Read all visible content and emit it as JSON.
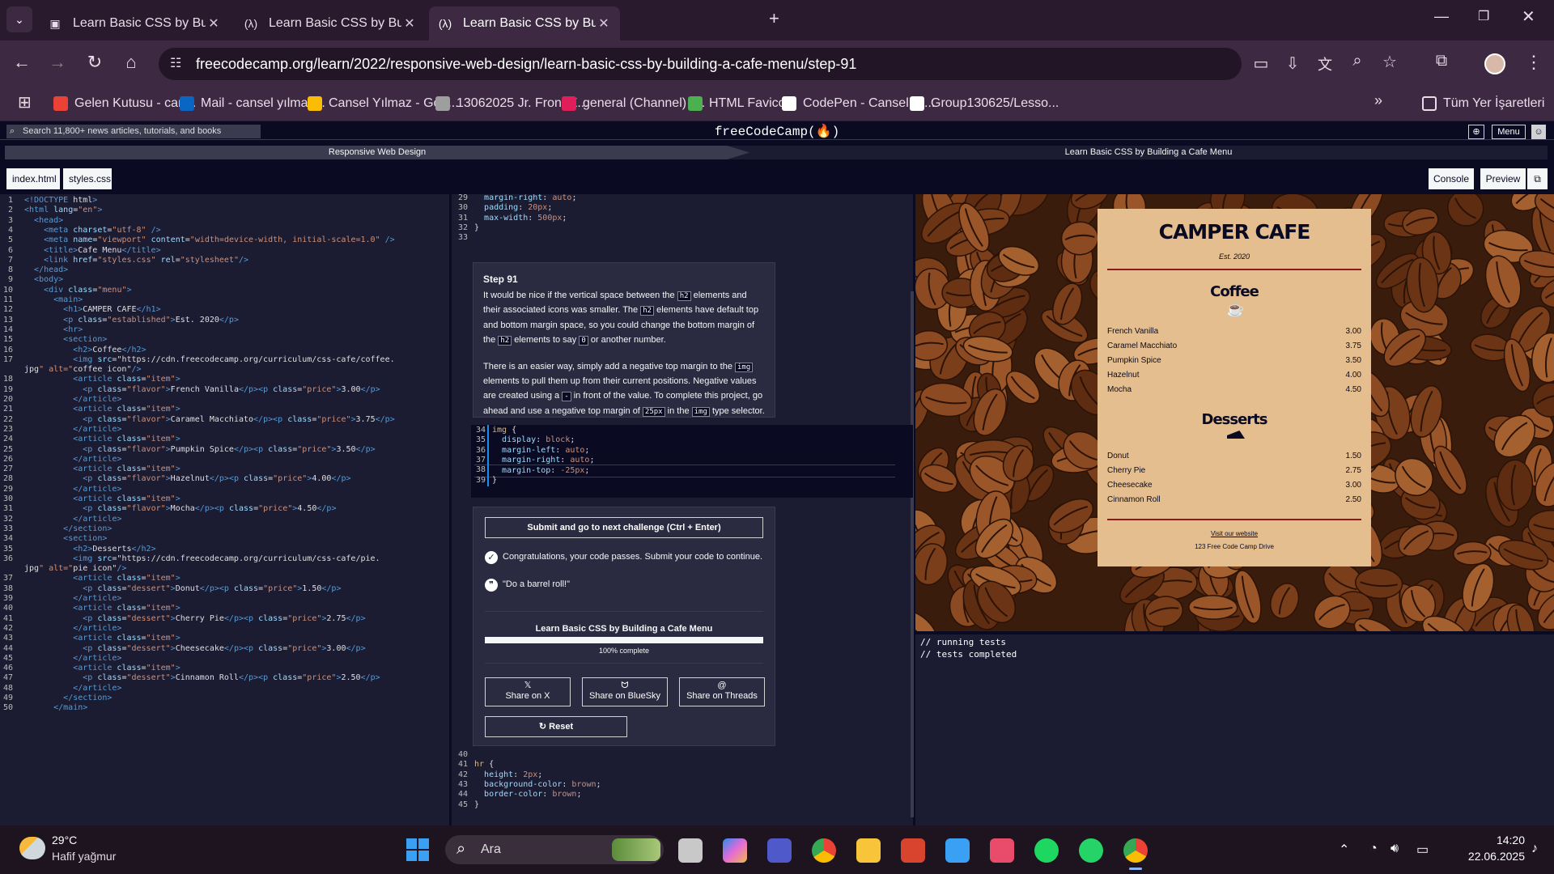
{
  "browser": {
    "tabs": [
      {
        "title": "Learn Basic CSS by Building a C",
        "icon": "document-icon"
      },
      {
        "title": "Learn Basic CSS by Building a C",
        "icon": "fcc-icon"
      },
      {
        "title": "Learn Basic CSS by Building a C",
        "icon": "fcc-icon"
      }
    ],
    "url": "freecodecamp.org/learn/2022/responsive-web-design/learn-basic-css-by-building-a-cafe-menu/step-91",
    "bookmarks": [
      {
        "label": "Gelen Kutusu - can...",
        "color": "#ea4335"
      },
      {
        "label": "Mail - cansel yılmaz...",
        "color": "#0a66c2"
      },
      {
        "label": "Cansel Yılmaz - Goo...",
        "color": "#fbbc04"
      },
      {
        "label": "13062025 Jr. Front E...",
        "color": "#9e9e9e"
      },
      {
        "label": "general (Channel) -...",
        "color": "#e01e5a"
      },
      {
        "label": "HTML Favicon",
        "color": "#4caf50"
      },
      {
        "label": "CodePen - Cansel Yı...",
        "color": "#ffffff"
      },
      {
        "label": "Group130625/Lesso...",
        "color": "#ffffff"
      }
    ],
    "all_bookmarks": "Tüm Yer İşaretleri"
  },
  "fcc": {
    "search_placeholder": "Search 11,800+ news articles, tutorials, and books",
    "logo": "freeCodeCamp(🔥)",
    "menu": "Menu",
    "crumb1": "Responsive Web Design",
    "crumb2": "Learn Basic CSS by Building a Cafe Menu",
    "file_tabs": [
      "index.html",
      "styles.css"
    ],
    "console_btn": "Console",
    "preview_btn": "Preview"
  },
  "html_lines": [
    "<!DOCTYPE html>",
    "<html lang=\"en\">",
    "  <head>",
    "    <meta charset=\"utf-8\" />",
    "    <meta name=\"viewport\" content=\"width=device-width, initial-scale=1.0\" />",
    "    <title>Cafe Menu</title>",
    "    <link href=\"styles.css\" rel=\"stylesheet\"/>",
    "  </head>",
    "  <body>",
    "    <div class=\"menu\">",
    "      <main>",
    "        <h1>CAMPER CAFE</h1>",
    "        <p class=\"established\">Est. 2020</p>",
    "        <hr>",
    "        <section>",
    "          <h2>Coffee</h2>",
    "          <img src=\"https://cdn.freecodecamp.org/curriculum/css-cafe/coffee.",
    "jpg\" alt=\"coffee icon\"/>",
    "          <article class=\"item\">",
    "            <p class=\"flavor\">French Vanilla</p><p class=\"price\">3.00</p>",
    "          </article>",
    "          <article class=\"item\">",
    "            <p class=\"flavor\">Caramel Macchiato</p><p class=\"price\">3.75</p>",
    "          </article>",
    "          <article class=\"item\">",
    "            <p class=\"flavor\">Pumpkin Spice</p><p class=\"price\">3.50</p>",
    "          </article>",
    "          <article class=\"item\">",
    "            <p class=\"flavor\">Hazelnut</p><p class=\"price\">4.00</p>",
    "          </article>",
    "          <article class=\"item\">",
    "            <p class=\"flavor\">Mocha</p><p class=\"price\">4.50</p>",
    "          </article>",
    "        </section>",
    "        <section>",
    "          <h2>Desserts</h2>",
    "          <img src=\"https://cdn.freecodecamp.org/curriculum/css-cafe/pie.",
    "jpg\" alt=\"pie icon\"/>",
    "          <article class=\"item\">",
    "            <p class=\"dessert\">Donut</p><p class=\"price\">1.50</p>",
    "          </article>",
    "          <article class=\"item\">",
    "            <p class=\"dessert\">Cherry Pie</p><p class=\"price\">2.75</p>",
    "          </article>",
    "          <article class=\"item\">",
    "            <p class=\"dessert\">Cheesecake</p><p class=\"price\">3.00</p>",
    "          </article>",
    "          <article class=\"item\">",
    "            <p class=\"dessert\">Cinnamon Roll</p><p class=\"price\">2.50</p>",
    "          </article>",
    "        </section>",
    "      </main>"
  ],
  "html_line_numbers": [
    "1",
    "2",
    "3",
    "4",
    "5",
    "6",
    "7",
    "8",
    "9",
    "10",
    "11",
    "12",
    "13",
    "14",
    "15",
    "16",
    "17",
    "",
    "18",
    "19",
    "20",
    "21",
    "22",
    "23",
    "24",
    "25",
    "26",
    "27",
    "28",
    "29",
    "30",
    "31",
    "32",
    "33",
    "34",
    "35",
    "36",
    "",
    "37",
    "38",
    "39",
    "40",
    "41",
    "42",
    "43",
    "44",
    "45",
    "46",
    "47",
    "48",
    "49",
    "50"
  ],
  "css_top": [
    {
      "n": "29",
      "t": "  margin-right: auto;"
    },
    {
      "n": "30",
      "t": "  padding: 20px;"
    },
    {
      "n": "31",
      "t": "  max-width: 500px;"
    },
    {
      "n": "32",
      "t": "}"
    },
    {
      "n": "33",
      "t": ""
    }
  ],
  "instructions": {
    "title": "Step 91",
    "p1_a": "It would be nice if the vertical space between the ",
    "p1_b": " elements and their associated icons was smaller. The ",
    "p1_c": " elements have default top and bottom margin space, so you could change the bottom margin of the ",
    "p1_d": " elements to say ",
    "p1_e": " or another number.",
    "code_h2": "h2",
    "code_0": "0",
    "p2_a": "There is an easier way, simply add a negative top margin to the ",
    "p2_b": " elements to pull them up from their current positions. Negative values are created using a ",
    "p2_c": " in front of the value. To complete this project, go ahead and use a negative top margin of ",
    "p2_d": " in the ",
    "p2_e": " type selector.",
    "code_img": "img",
    "code_minus": "-",
    "code_25": "25px"
  },
  "css_mid": [
    {
      "n": "34",
      "t": "img {"
    },
    {
      "n": "35",
      "t": "  display: block;"
    },
    {
      "n": "36",
      "t": "  margin-left: auto;"
    },
    {
      "n": "37",
      "t": "  margin-right: auto;"
    },
    {
      "n": "38",
      "t": "  margin-top: -25px;"
    },
    {
      "n": "39",
      "t": "}"
    }
  ],
  "panel": {
    "submit": "Submit and go to next challenge (Ctrl + Enter)",
    "congrats": "Congratulations, your code passes. Submit your code to continue.",
    "quote": "\"Do a barrel roll!\"",
    "course": "Learn Basic CSS by Building a Cafe Menu",
    "progress_pct": 100,
    "progress_label": "100% complete",
    "share_x": "Share on X",
    "share_bluesky": "Share on BlueSky",
    "share_threads": "Share on Threads",
    "reset": "Reset"
  },
  "css_bottom": [
    {
      "n": "40",
      "t": ""
    },
    {
      "n": "41",
      "t": "hr {"
    },
    {
      "n": "42",
      "t": "  height: 2px;"
    },
    {
      "n": "43",
      "t": "  background-color: brown;"
    },
    {
      "n": "44",
      "t": "  border-color: brown;"
    },
    {
      "n": "45",
      "t": "}"
    }
  ],
  "menu": {
    "title": "CAMPER CAFE",
    "est": "Est. 2020",
    "coffee_heading": "Coffee",
    "coffee": [
      {
        "name": "French Vanilla",
        "price": "3.00"
      },
      {
        "name": "Caramel Macchiato",
        "price": "3.75"
      },
      {
        "name": "Pumpkin Spice",
        "price": "3.50"
      },
      {
        "name": "Hazelnut",
        "price": "4.00"
      },
      {
        "name": "Mocha",
        "price": "4.50"
      }
    ],
    "dessert_heading": "Desserts",
    "desserts": [
      {
        "name": "Donut",
        "price": "1.50"
      },
      {
        "name": "Cherry Pie",
        "price": "2.75"
      },
      {
        "name": "Cheesecake",
        "price": "3.00"
      },
      {
        "name": "Cinnamon Roll",
        "price": "2.50"
      }
    ],
    "website": "Visit our website",
    "address": "123 Free Code Camp Drive"
  },
  "console": [
    "// running tests",
    "// tests completed"
  ],
  "taskbar": {
    "temp": "29°C",
    "weather": "Hafif yağmur",
    "search": "Ara",
    "time": "14:20",
    "date": "22.06.2025"
  }
}
